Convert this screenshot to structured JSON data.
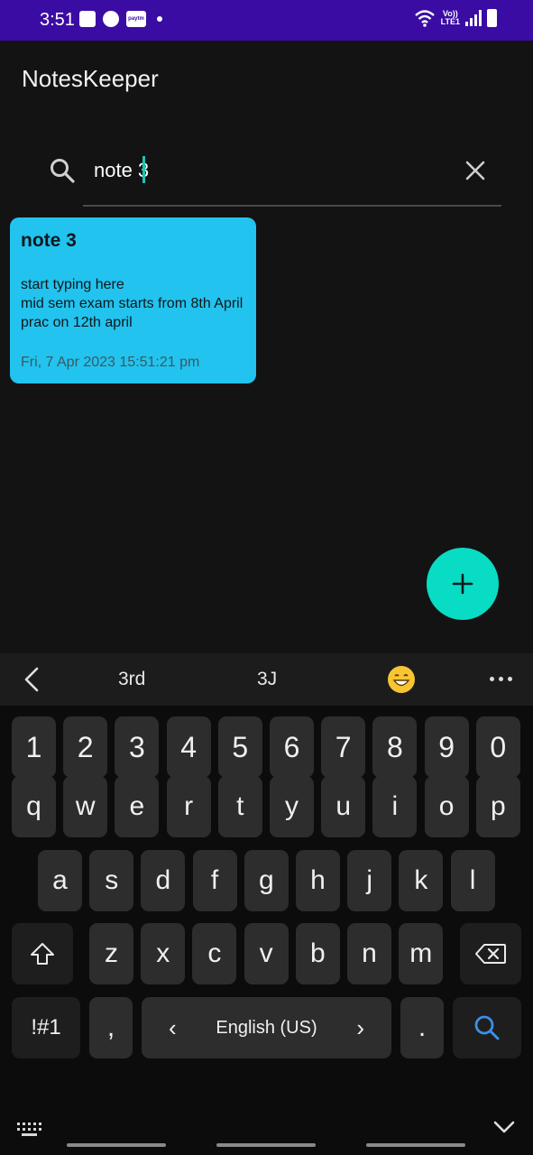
{
  "status_bar": {
    "time": "3:51",
    "paytm_label": "paytm",
    "network_label_1": "Vo))",
    "network_label_2": "LTE1"
  },
  "app": {
    "title": "NotesKeeper"
  },
  "search": {
    "value": "note 3",
    "icon": "search-icon",
    "clear_icon": "close-icon"
  },
  "notes": [
    {
      "title": "note 3",
      "body_lines": [
        "start typing here",
        "mid sem exam starts from 8th April",
        "prac on 12th april"
      ],
      "date": "Fri, 7 Apr 2023 15:51:21 pm",
      "color": "#22c3ee"
    }
  ],
  "fab": {
    "icon": "plus-icon",
    "color": "#09dcc4"
  },
  "keyboard": {
    "suggestions": [
      "3rd",
      "3J"
    ],
    "emoji": "grinning-face-icon",
    "row_numbers": [
      "1",
      "2",
      "3",
      "4",
      "5",
      "6",
      "7",
      "8",
      "9",
      "0"
    ],
    "row_1": [
      "q",
      "w",
      "e",
      "r",
      "t",
      "y",
      "u",
      "i",
      "o",
      "p"
    ],
    "row_2": [
      "a",
      "s",
      "d",
      "f",
      "g",
      "h",
      "j",
      "k",
      "l"
    ],
    "row_3": [
      "z",
      "x",
      "c",
      "v",
      "b",
      "n",
      "m"
    ],
    "symbols_label": "!#1",
    "comma_label": ",",
    "space_label": "English (US)",
    "period_label": ".",
    "left_arrow": "‹",
    "right_arrow": "›"
  },
  "colors": {
    "status_bar": "#3a0ca3",
    "background": "#131313",
    "accent": "#09dcc4"
  }
}
